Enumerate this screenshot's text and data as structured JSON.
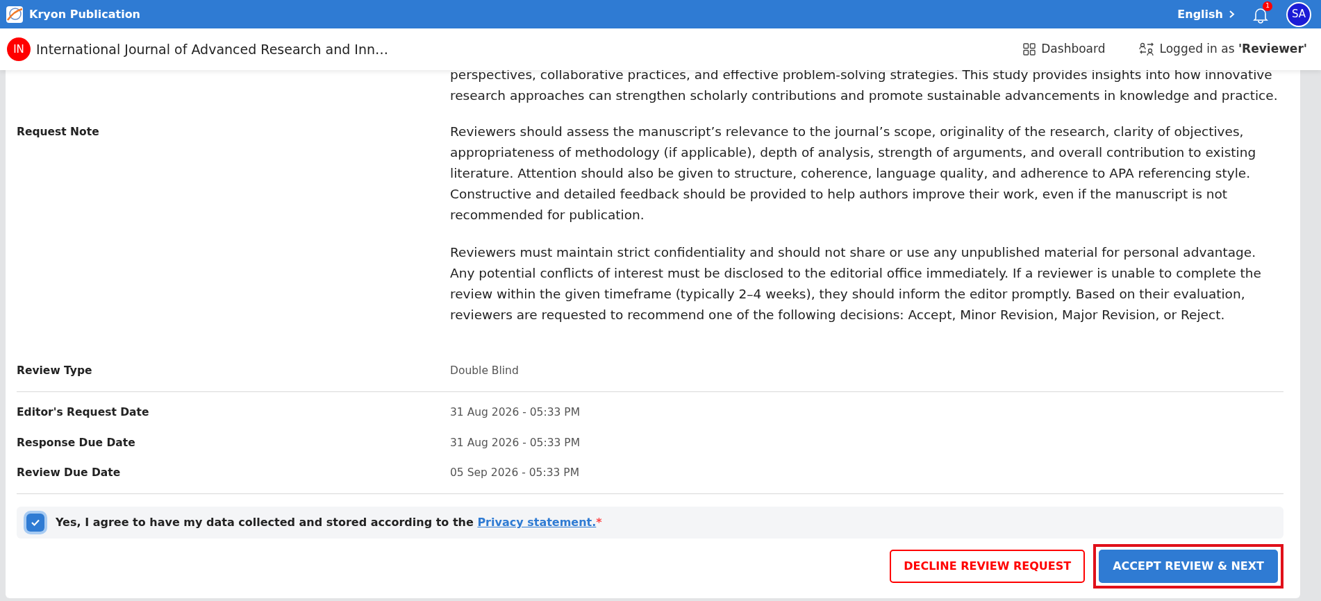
{
  "app": {
    "name": "Kryon Publication",
    "language": "English",
    "notifications": "1",
    "avatar": "SA"
  },
  "journal": {
    "initials": "IN",
    "title": "International Journal of Advanced Research and Inn…"
  },
  "nav": [
    {
      "kind": "dashboard",
      "label": "Dashboard"
    },
    {
      "kind": "role",
      "label": "Logged in as **'Reviewer'**"
    }
  ],
  "abstract_tail": "perspectives, collaborative practices, and effective problem-solving strategies. This study provides insights into how innovative research approaches can strengthen scholarly contributions and promote sustainable advancements in knowledge and practice.",
  "sections": [
    {
      "rows": [
        {
          "label": "Request Note",
          "paragraphs": [
            "Reviewers should assess the manuscript’s relevance to the journal’s scope, originality of the research, clarity of objectives, appropriateness of methodology (if applicable), depth of analysis, strength of arguments, and overall contribution to existing literature. Attention should also be given to structure, coherence, language quality, and adherence to APA referencing style. Constructive and detailed feedback should be provided to help authors improve their work, even if the manuscript is not recommended for publication.",
            "Reviewers must maintain strict confidentiality and should not share or use any unpublished material for personal advantage. Any potential conflicts of interest must be disclosed to the editorial office immediately. If a reviewer is unable to complete the review within the given timeframe (typically 2–4 weeks), they should inform the editor promptly. Based on their evaluation, reviewers are requested to recommend one of the following decisions: Accept, Minor Revision, Major Revision, or Reject."
          ]
        },
        {
          "label": "Review Type",
          "value": "Double Blind"
        }
      ]
    },
    {
      "rows": [
        {
          "label": "Editor's Request Date",
          "value": "31 Aug 2026 - 05:33 PM"
        },
        {
          "label": "Response Due Date",
          "value": "31 Aug 2026 - 05:33 PM"
        },
        {
          "label": "Review Due Date",
          "value": "05 Sep 2026 - 05:33 PM"
        }
      ]
    }
  ],
  "consent": {
    "checked": true,
    "text": "Yes, I agree to have my data collected and stored according to the",
    "link": "Privacy statement.",
    "required_mark": "*"
  },
  "buttons": [
    {
      "kind": "outline",
      "label": "DECLINE REVIEW REQUEST",
      "highlighted": false
    },
    {
      "kind": "primary",
      "label": "ACCEPT REVIEW & NEXT",
      "highlighted": true
    }
  ]
}
